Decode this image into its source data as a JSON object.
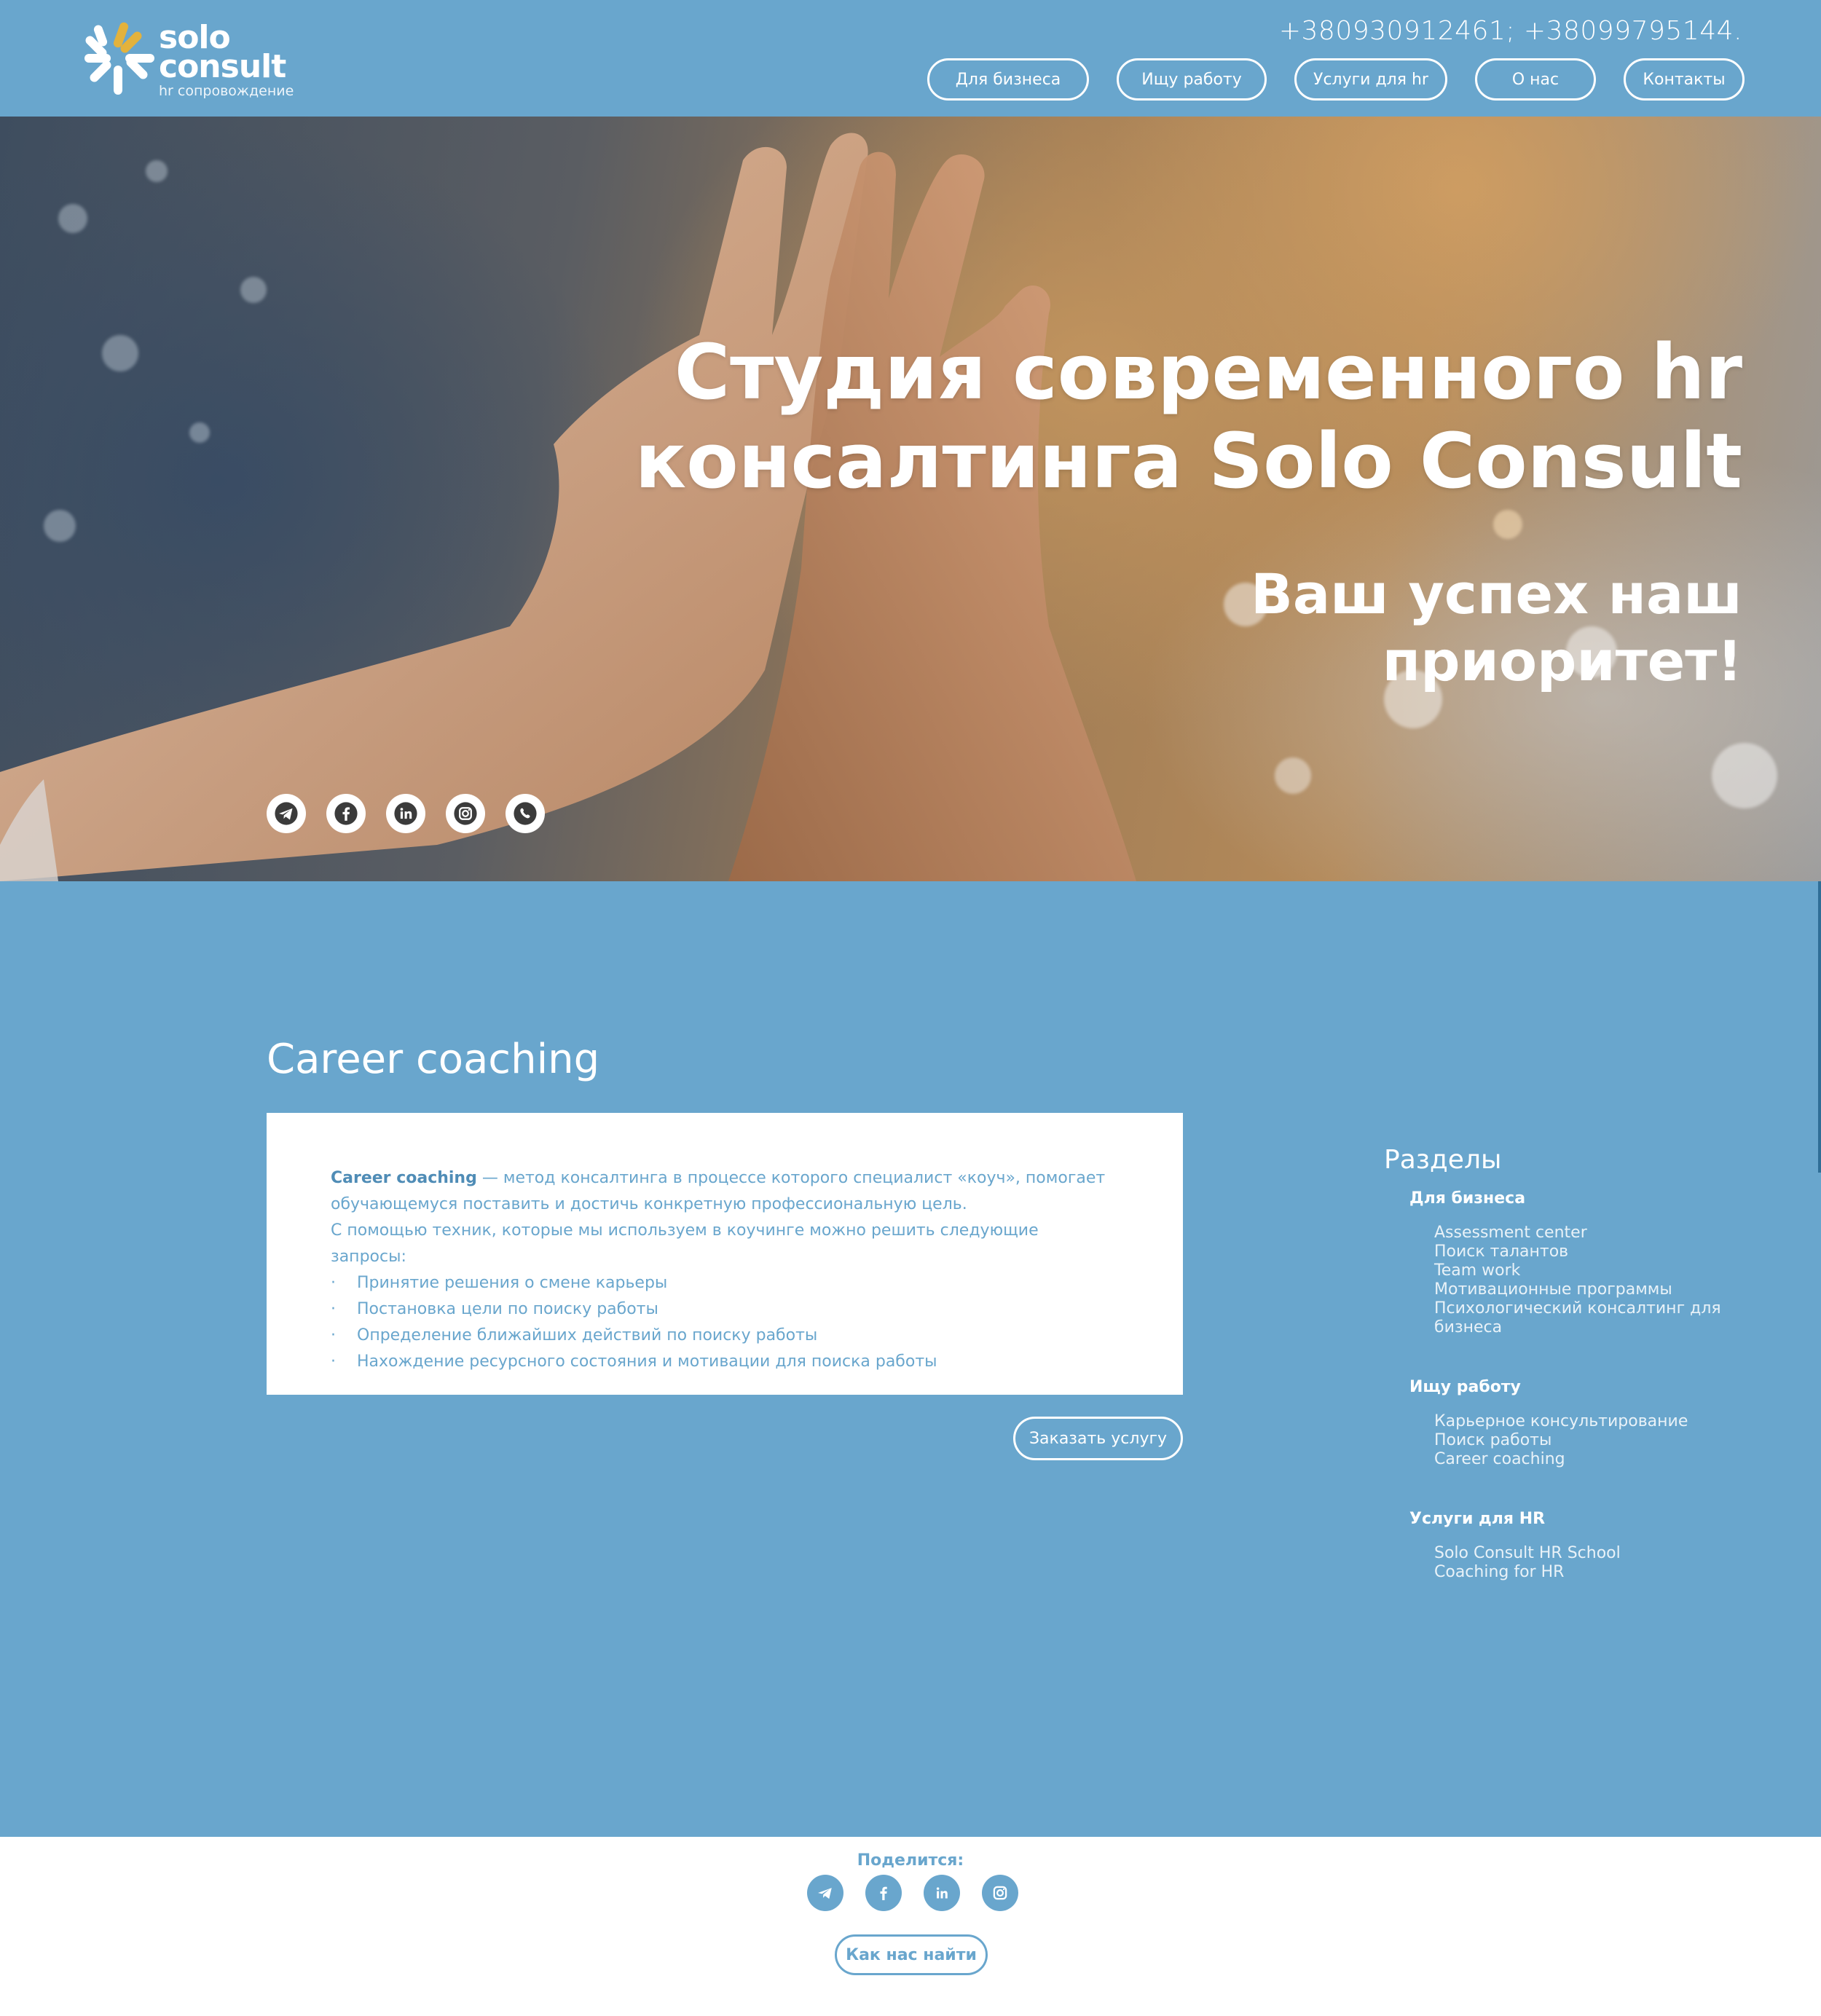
{
  "brand": {
    "logo_solo": "solo",
    "logo_consult": "consult",
    "logo_sub": "hr сопровождение",
    "accent": "#69a6cd",
    "logo_accent": "#e3b23c"
  },
  "header": {
    "phones": "+380930912461;  +38099795144."
  },
  "nav": [
    {
      "label": "Для бизнеса"
    },
    {
      "label": "Ищу работу"
    },
    {
      "label": "Услуги для hr"
    },
    {
      "label": "О нас"
    },
    {
      "label": "Контакты"
    }
  ],
  "hero": {
    "title_line1": "Студия современного hr",
    "title_line2": "консалтинга Solo Consult",
    "sub_line1": "Ваш успех наш",
    "sub_line2": "приоритет!",
    "social_icons": [
      "telegram-icon",
      "facebook-icon",
      "linkedin-icon",
      "instagram-icon",
      "viber-icon"
    ]
  },
  "main": {
    "title": "Career coaching",
    "card": {
      "lead_bold": "Career coaching",
      "lead_rest": " — метод консалтинга в процессе которого специалист «коуч», помогает",
      "line2": "обучающемуся поставить и достичь конкретную профессиональную цель.",
      "line3": "С помощью техник, которые мы используем в коучинге можно решить следующие запросы:",
      "bullets": [
        "Принятие решения о смене карьеры",
        "Постановка цели  по поиску работы",
        "Определение ближайших действий по поиску работы",
        "Нахождение ресурсного состояния и мотивации для поиска работы"
      ]
    },
    "order_button": "Заказать услугу"
  },
  "sidebar": {
    "title": "Разделы",
    "groups": [
      {
        "heading": "Для бизнеса",
        "items": [
          "Assessment center",
          "Поиск талантов",
          "Team work",
          "Мотивационные программы",
          "Психологический консалтинг для",
          "бизнеса"
        ]
      },
      {
        "heading": "Ищу работу",
        "items": [
          "Карьерное консультирование",
          "Поиск работы",
          "Career coaching"
        ]
      },
      {
        "heading": "Услуги для HR",
        "items": [
          "Solo Consult HR School",
          "Coaching for HR"
        ]
      }
    ]
  },
  "footer": {
    "share_label": "Поделится:",
    "social_icons": [
      "telegram-icon",
      "facebook-icon",
      "linkedin-icon",
      "instagram-icon"
    ],
    "find_button": "Как нас найти"
  }
}
